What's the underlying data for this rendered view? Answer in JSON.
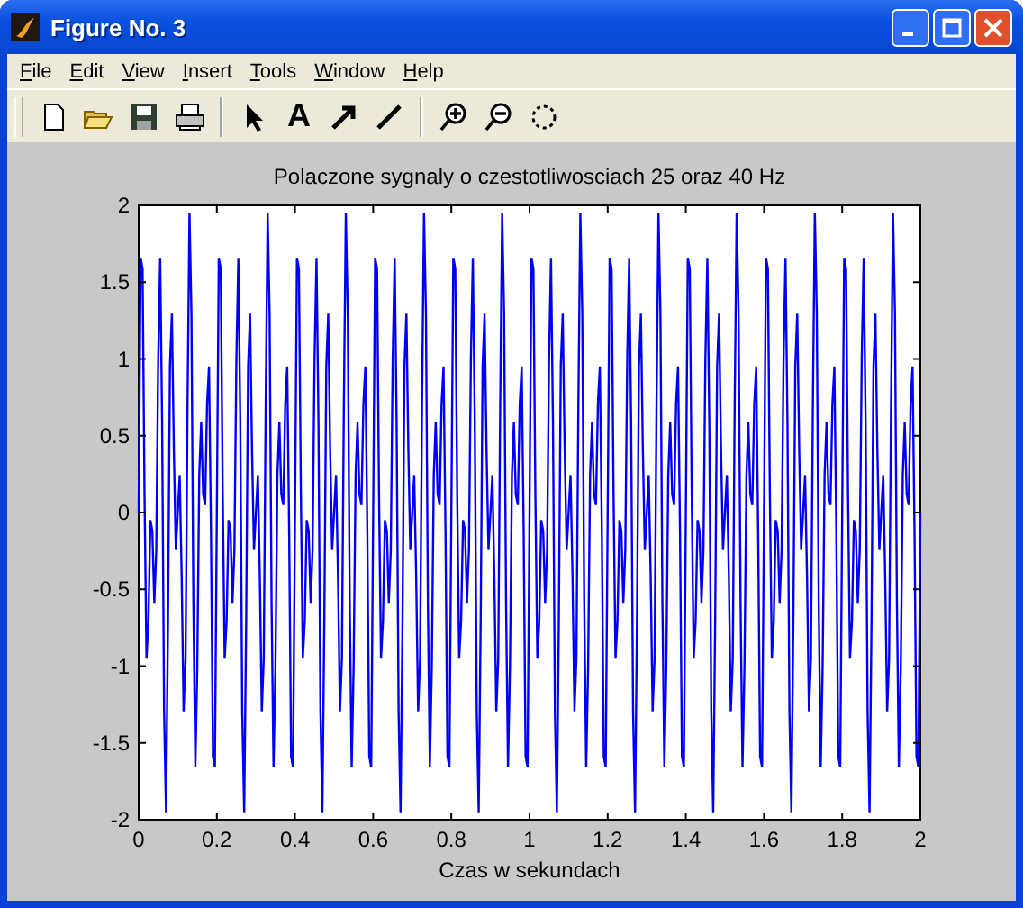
{
  "window": {
    "title": "Figure No. 3"
  },
  "menu": [
    "File",
    "Edit",
    "View",
    "Insert",
    "Tools",
    "Window",
    "Help"
  ],
  "toolbar": [
    {
      "kind": "new"
    },
    {
      "kind": "open"
    },
    {
      "kind": "save"
    },
    {
      "kind": "print"
    },
    {
      "kind": "sep"
    },
    {
      "kind": "pointer"
    },
    {
      "kind": "text",
      "label": "A"
    },
    {
      "kind": "arrow"
    },
    {
      "kind": "line"
    },
    {
      "kind": "sep"
    },
    {
      "kind": "zoomin"
    },
    {
      "kind": "zoomout"
    },
    {
      "kind": "rotate"
    }
  ],
  "plot": {
    "title": "Polaczone sygnaly o czestotliwosciach 25 oraz 40 Hz",
    "xlabel": "Czas w sekundach",
    "xticks": [
      "0",
      "0.2",
      "0.4",
      "0.6",
      "0.8",
      "1",
      "1.2",
      "1.4",
      "1.6",
      "1.8",
      "2"
    ],
    "yticks": [
      "2",
      "1.5",
      "1",
      "0.5",
      "0",
      "-0.5",
      "-1",
      "-1.5",
      "-2"
    ]
  }
}
